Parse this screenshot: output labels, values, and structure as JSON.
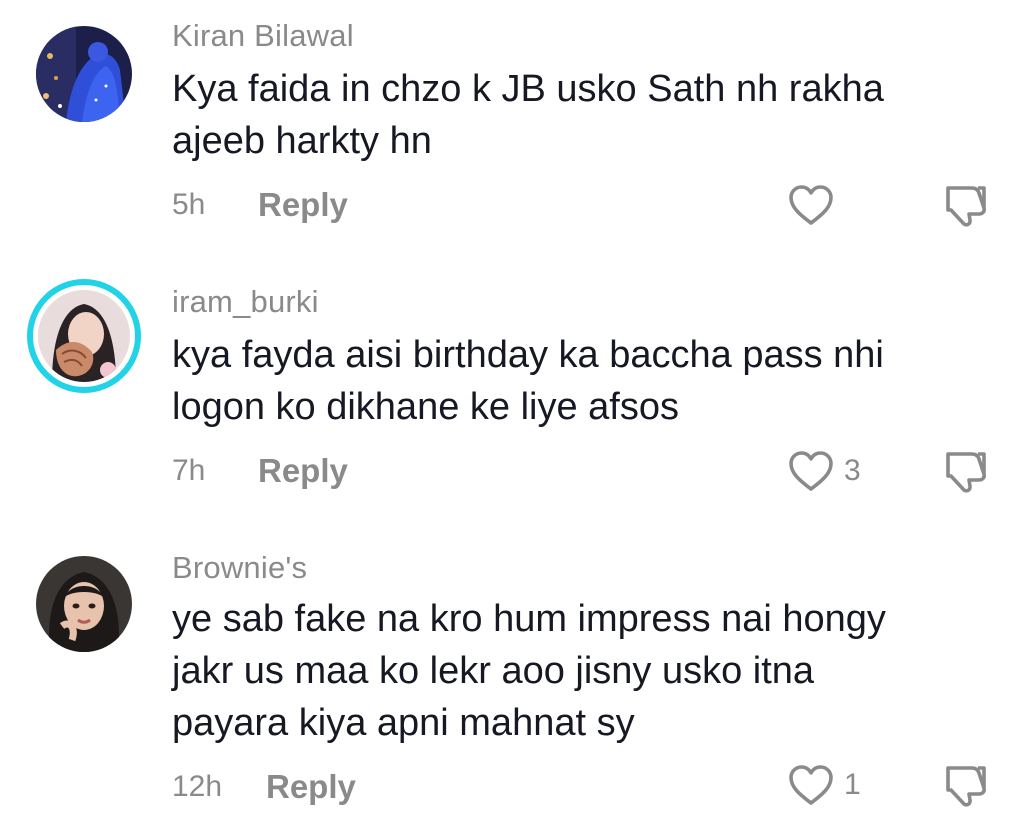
{
  "comments": [
    {
      "username": "Kiran Bilawal",
      "lines": [
        "Kya faida in chzo k JB usko Sath nh rakha",
        "ajeeb harkty hn"
      ],
      "time": "5h",
      "reply_label": "Reply",
      "likes": "",
      "avatar_icon": "avatar-blue-dress"
    },
    {
      "username": "iram_burki",
      "lines": [
        "kya fayda aisi birthday ka baccha pass nhi",
        "logon ko dikhane ke liye afsos"
      ],
      "time": "7h",
      "reply_label": "Reply",
      "likes": "3",
      "avatar_icon": "avatar-story-ring"
    },
    {
      "username": "Brownie's",
      "lines": [
        "ye sab fake na kro hum impress nai hongy",
        "jakr us maa ko lekr aoo jisny usko itna",
        "payara kiya apni mahnat sy"
      ],
      "time": "12h",
      "reply_label": "Reply",
      "likes": "1",
      "avatar_icon": "avatar-cartoon-girl"
    }
  ],
  "colors": {
    "text": "#161823",
    "muted": "#8a8a8a",
    "story_ring": "#22d3e8"
  }
}
